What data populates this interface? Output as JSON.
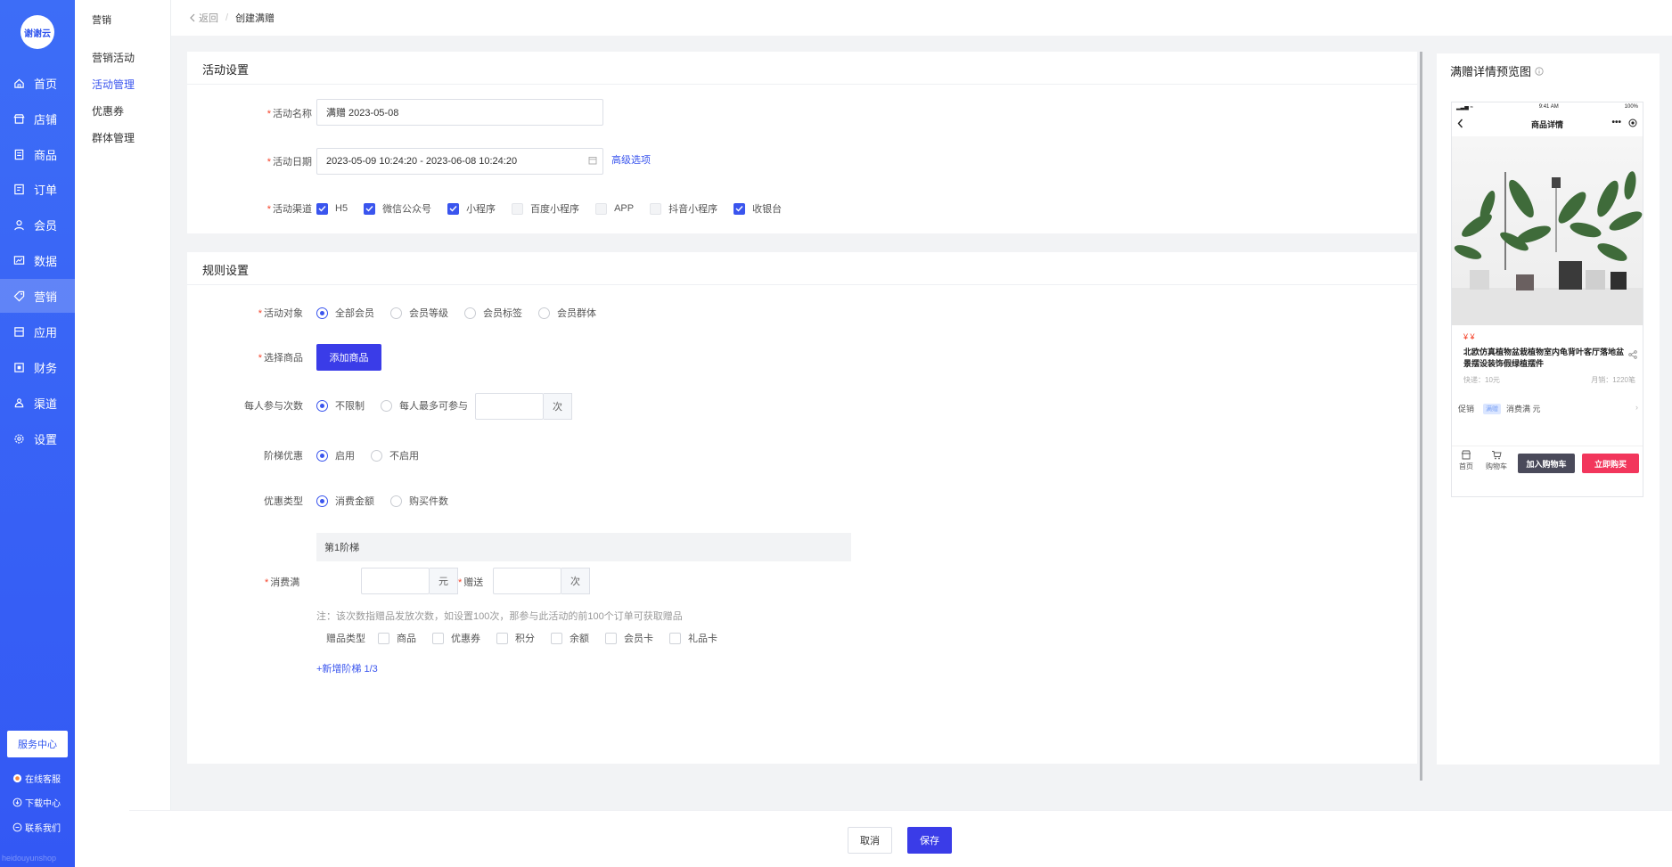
{
  "brand": {
    "logo_text": "谢谢云",
    "watermark": "heidouyunshop",
    "accent": "#3a55ee",
    "primary_button": "#3a3ce8",
    "nav_bg": "#3358f4"
  },
  "main_nav": {
    "items": [
      {
        "label": "首页",
        "icon": "home-icon"
      },
      {
        "label": "店铺",
        "icon": "store-icon"
      },
      {
        "label": "商品",
        "icon": "goods-icon"
      },
      {
        "label": "订单",
        "icon": "order-icon"
      },
      {
        "label": "会员",
        "icon": "user-icon"
      },
      {
        "label": "数据",
        "icon": "chart-icon"
      },
      {
        "label": "营销",
        "icon": "tag-icon",
        "active": true
      },
      {
        "label": "应用",
        "icon": "app-icon"
      },
      {
        "label": "财务",
        "icon": "finance-icon"
      },
      {
        "label": "渠道",
        "icon": "channel-icon"
      },
      {
        "label": "设置",
        "icon": "gear-icon"
      }
    ],
    "service_center": "服务中心",
    "footer_links": [
      "在线客服",
      "下载中心",
      "联系我们"
    ]
  },
  "sub_nav": {
    "title": "营销",
    "items": [
      "营销活动",
      "活动管理",
      "优惠券",
      "群体管理"
    ],
    "active_index": 1
  },
  "breadcrumb": {
    "back": "返回",
    "current": "创建满赠"
  },
  "activity_settings": {
    "title": "活动设置",
    "name_label": "活动名称",
    "name_value": "满赠  2023-05-08",
    "date_label": "活动日期",
    "date_value": "2023-05-09 10:24:20 - 2023-06-08 10:24:20",
    "advanced_link": "高级选项",
    "channel_label": "活动渠道",
    "channels": [
      {
        "label": "H5",
        "checked": true
      },
      {
        "label": "微信公众号",
        "checked": true
      },
      {
        "label": "小程序",
        "checked": true
      },
      {
        "label": "百度小程序",
        "checked": false
      },
      {
        "label": "APP",
        "checked": false
      },
      {
        "label": "抖音小程序",
        "checked": false
      },
      {
        "label": "收银台",
        "checked": true
      }
    ]
  },
  "rule_settings": {
    "title": "规则设置",
    "target_label": "活动对象",
    "targets": [
      {
        "label": "全部会员",
        "selected": true
      },
      {
        "label": "会员等级",
        "selected": false
      },
      {
        "label": "会员标签",
        "selected": false
      },
      {
        "label": "会员群体",
        "selected": false
      }
    ],
    "goods_label": "选择商品",
    "add_goods": "添加商品",
    "times_label": "每人参与次数",
    "times_options": [
      {
        "label": "不限制",
        "selected": true
      },
      {
        "label": "每人最多可参与",
        "selected": false
      }
    ],
    "times_unit": "次",
    "ladder_label": "阶梯优惠",
    "ladder_options": [
      {
        "label": "启用",
        "selected": true
      },
      {
        "label": "不启用",
        "selected": false
      }
    ],
    "type_label": "优惠类型",
    "type_options": [
      {
        "label": "消费金额",
        "selected": true
      },
      {
        "label": "购买件数",
        "selected": false
      }
    ],
    "tier": {
      "title": "第1阶梯",
      "spend_label": "消费满",
      "spend_unit": "元",
      "gift_label": "赠送",
      "gift_unit": "次",
      "note": "注：该次数指赠品发放次数，如设置100次，那参与此活动的前100个订单可获取赠品",
      "gift_type_label": "赠品类型",
      "gift_types": [
        "商品",
        "优惠券",
        "积分",
        "余额",
        "会员卡",
        "礼品卡"
      ]
    },
    "add_tier": "+新增阶梯 1/3"
  },
  "preview": {
    "title": "满赠详情预览图",
    "status_time": "9:41 AM",
    "status_battery": "100%",
    "page_title": "商品详情",
    "price": "¥ ¥",
    "product_name": "北欧仿真植物盆栽植物室内龟背叶客厅落地盆景摆设装饰假绿植摆件",
    "shipping": "快递：10元",
    "monthly_sales": "月销：1220笔",
    "promo_label": "促销",
    "promo_tag": "满赠",
    "promo_text": "消费满 元",
    "bar_home": "首页",
    "bar_cart": "购物车",
    "add_cart": "加入购物车",
    "buy_now": "立即购买",
    "add_cart_color": "#4a4a5a",
    "buy_now_color": "#f2365c"
  },
  "footer": {
    "cancel": "取消",
    "save": "保存"
  }
}
